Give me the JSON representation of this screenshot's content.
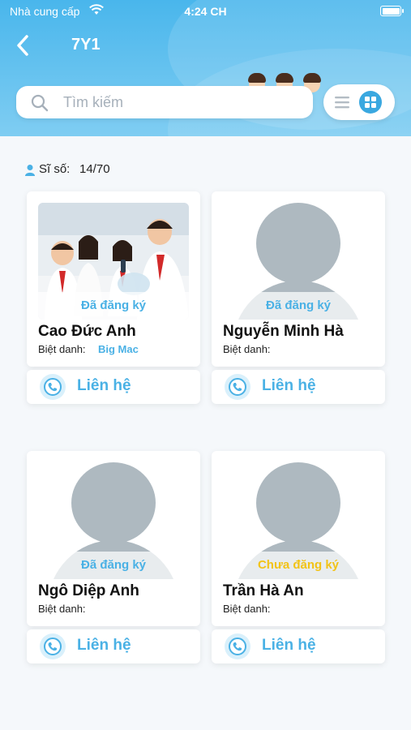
{
  "status_bar": {
    "carrier": "Nhà cung cấp",
    "time": "4:24 CH"
  },
  "header": {
    "title": "7Y1"
  },
  "search": {
    "placeholder": "Tìm kiếm"
  },
  "class_info": {
    "count_label": "Sĩ số:",
    "count_value": "14/70"
  },
  "colors": {
    "accent": "#4ab1e5",
    "header": "#49b6ec",
    "unregistered": "#f2c317"
  },
  "students": [
    {
      "name": "Cao Đức Anh",
      "status": "Đã đăng ký",
      "nickname_label": "Biệt danh:",
      "nickname": "Big Mac",
      "contact": "Liên hệ"
    },
    {
      "name": "Nguyễn Minh Hà",
      "status": "Đã đăng ký",
      "nickname_label": "Biệt danh:",
      "nickname": "",
      "contact": "Liên hệ"
    },
    {
      "name": "Ngô Diệp Anh",
      "status": "Đã đăng ký",
      "nickname_label": "Biệt danh:",
      "nickname": "",
      "contact": "Liên hệ"
    },
    {
      "name": "Trần Hà An",
      "status": "Chưa đăng ký",
      "nickname_label": "Biệt danh:",
      "nickname": "",
      "contact": "Liên hệ"
    }
  ]
}
